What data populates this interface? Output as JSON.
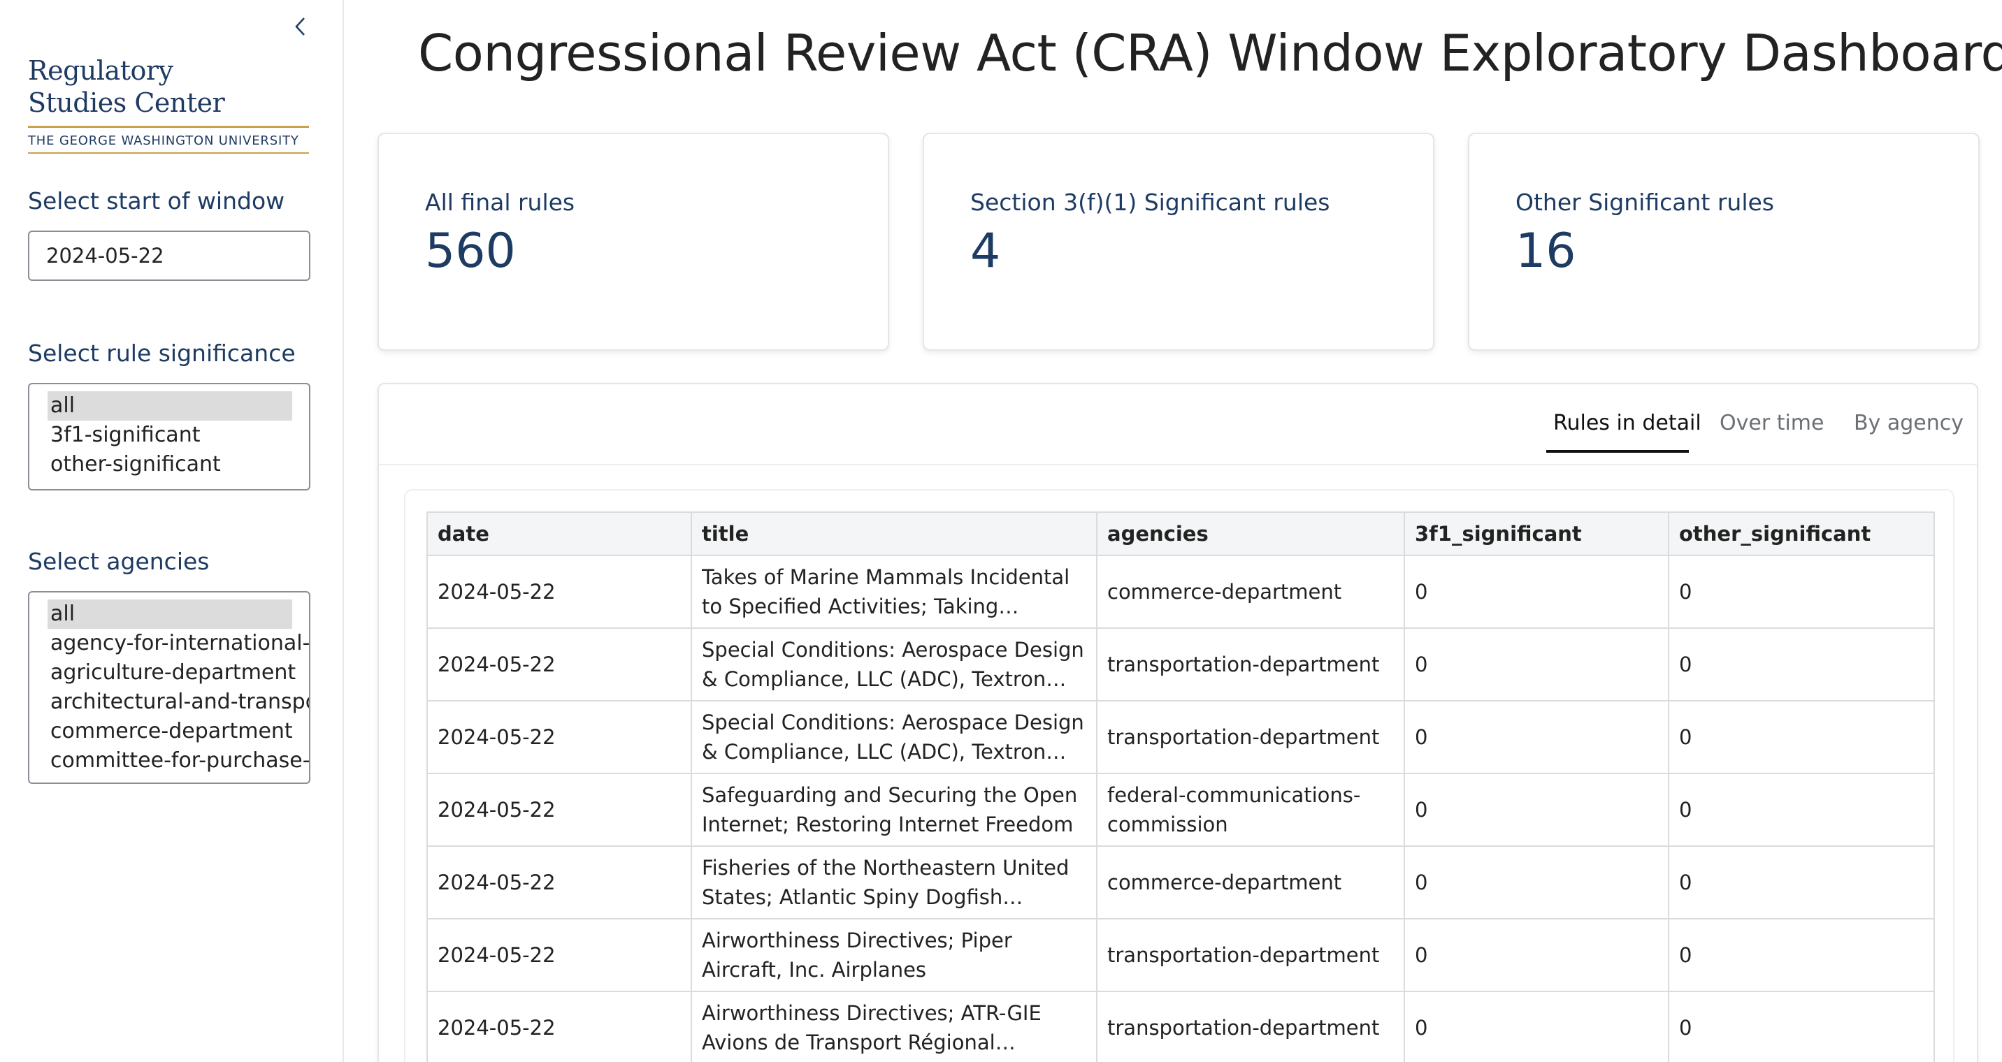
{
  "sidebar": {
    "logo": {
      "line1": "Regulatory",
      "line2": "Studies Center",
      "university": "THE GEORGE WASHINGTON UNIVERSITY"
    },
    "collapse_icon": "chevron-left-icon",
    "window_start": {
      "label": "Select start of window",
      "value": "2024-05-22"
    },
    "significance": {
      "label": "Select rule significance",
      "options": [
        "all",
        "3f1-significant",
        "other-significant"
      ],
      "selected": "all"
    },
    "agencies": {
      "label": "Select agencies",
      "options": [
        "all",
        "agency-for-international-development",
        "agriculture-department",
        "architectural-and-transportation-barriers-compliance-board",
        "commerce-department",
        "committee-for-purchase-from-people-who-are-blind-or-severely-disabled"
      ],
      "selected": "all"
    }
  },
  "main": {
    "title": "Congressional Review Act (CRA) Window Exploratory Dashboard",
    "cards": [
      {
        "label": "All final rules",
        "value": "560"
      },
      {
        "label": "Section 3(f)(1) Significant rules",
        "value": "4"
      },
      {
        "label": "Other Significant rules",
        "value": "16"
      }
    ],
    "tabs": [
      {
        "label": "Rules in detail",
        "active": true
      },
      {
        "label": "Over time",
        "active": false
      },
      {
        "label": "By agency",
        "active": false
      }
    ],
    "table": {
      "columns": [
        "date",
        "title",
        "agencies",
        "3f1_significant",
        "other_significant"
      ],
      "rows": [
        [
          "2024-05-22",
          "Takes of Marine Mammals Incidental to Specified Activities; Taking Marine...",
          "commerce-department",
          "0",
          "0"
        ],
        [
          "2024-05-22",
          "Special Conditions: Aerospace Design & Compliance, LLC (ADC), Textron Aviation...",
          "transportation-department",
          "0",
          "0"
        ],
        [
          "2024-05-22",
          "Special Conditions: Aerospace Design & Compliance, LLC (ADC), Textron Aviation...",
          "transportation-department",
          "0",
          "0"
        ],
        [
          "2024-05-22",
          "Safeguarding and Securing the Open Internet; Restoring Internet Freedom",
          "federal-communications-commission",
          "0",
          "0"
        ],
        [
          "2024-05-22",
          "Fisheries of the Northeastern United States; Atlantic Spiny Dogfish Fishery;...",
          "commerce-department",
          "0",
          "0"
        ],
        [
          "2024-05-22",
          "Airworthiness Directives; Piper Aircraft, Inc. Airplanes",
          "transportation-department",
          "0",
          "0"
        ],
        [
          "2024-05-22",
          "Airworthiness Directives; ATR-GIE Avions de Transport Régional Airplanes",
          "transportation-department",
          "0",
          "0"
        ]
      ]
    }
  }
}
